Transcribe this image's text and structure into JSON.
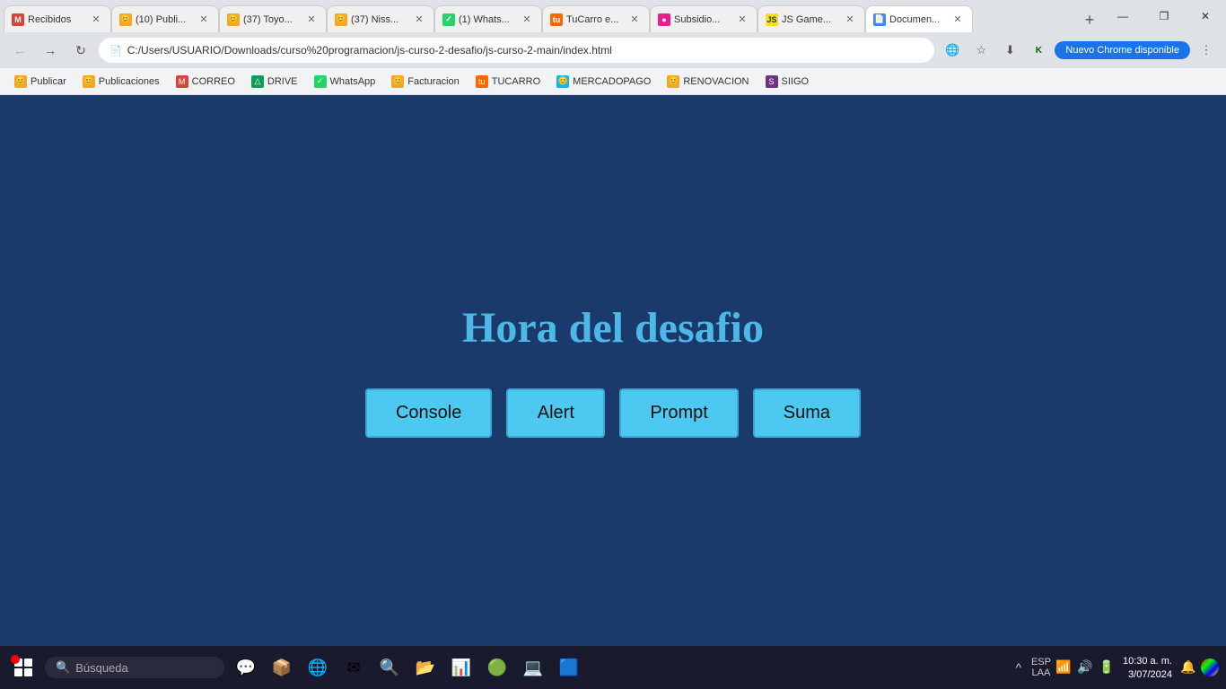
{
  "tabs": [
    {
      "id": "gmail",
      "label": "Recibidos",
      "favicon_type": "fav-gmail",
      "favicon": "M",
      "active": false,
      "closable": true
    },
    {
      "id": "pub1",
      "label": "(10) Publi...",
      "favicon_type": "fav-smile",
      "favicon": "😊",
      "active": false,
      "closable": true
    },
    {
      "id": "toyo",
      "label": "(37) Toyo...",
      "favicon_type": "fav-smile",
      "favicon": "😊",
      "active": false,
      "closable": true
    },
    {
      "id": "niss",
      "label": "(37) Niss...",
      "favicon_type": "fav-smile",
      "favicon": "😊",
      "active": false,
      "closable": true
    },
    {
      "id": "whatsapp",
      "label": "(1) Whats...",
      "favicon_type": "fav-whatsapp",
      "favicon": "✓",
      "active": false,
      "closable": true
    },
    {
      "id": "tucarro",
      "label": "TuCarro e...",
      "favicon_type": "fav-tucarro",
      "favicon": "tu",
      "active": false,
      "closable": true
    },
    {
      "id": "subsidio",
      "label": "Subsidio...",
      "favicon_type": "fav-subsidio",
      "favicon": "●",
      "active": false,
      "closable": true
    },
    {
      "id": "jsgame",
      "label": "JS Game...",
      "favicon_type": "fav-js",
      "favicon": "JS",
      "active": false,
      "closable": true
    },
    {
      "id": "documen",
      "label": "Documen...",
      "favicon_type": "fav-doc",
      "favicon": "📄",
      "active": true,
      "closable": true
    }
  ],
  "address_bar": {
    "url": "C:/Users/USUARIO/Downloads/curso%20programacion/js-curso-2-desafio/js-curso-2-main/index.html",
    "icon": "📄"
  },
  "chrome_update": "Nuevo Chrome disponible",
  "bookmarks": [
    {
      "label": "Publicar",
      "favicon": "😊"
    },
    {
      "label": "Publicaciones",
      "favicon": "😊"
    },
    {
      "label": "CORREO",
      "favicon": "M"
    },
    {
      "label": "DRIVE",
      "favicon": "△"
    },
    {
      "label": "WhatsApp",
      "favicon": "✓"
    },
    {
      "label": "Facturacion",
      "favicon": "😊"
    },
    {
      "label": "TUCARRO",
      "favicon": "tu"
    },
    {
      "label": "MERCADOPAGO",
      "favicon": "😊"
    },
    {
      "label": "RENOVACION",
      "favicon": "😊"
    },
    {
      "label": "SIIGO",
      "favicon": "S"
    }
  ],
  "page": {
    "title": "Hora del desafio",
    "buttons": [
      "Console",
      "Alert",
      "Prompt",
      "Suma"
    ]
  },
  "taskbar": {
    "search_placeholder": "Búsqueda",
    "apps": [
      "💬",
      "📦",
      "🌐",
      "✉",
      "🔍",
      "📂",
      "📊",
      "🟢",
      "💻",
      "🟦"
    ],
    "time": "10:30 a. m.",
    "date": "3/07/2024",
    "lang": "ESP",
    "lang2": "LAA"
  },
  "window_controls": {
    "minimize": "—",
    "maximize": "❐",
    "close": "✕"
  }
}
